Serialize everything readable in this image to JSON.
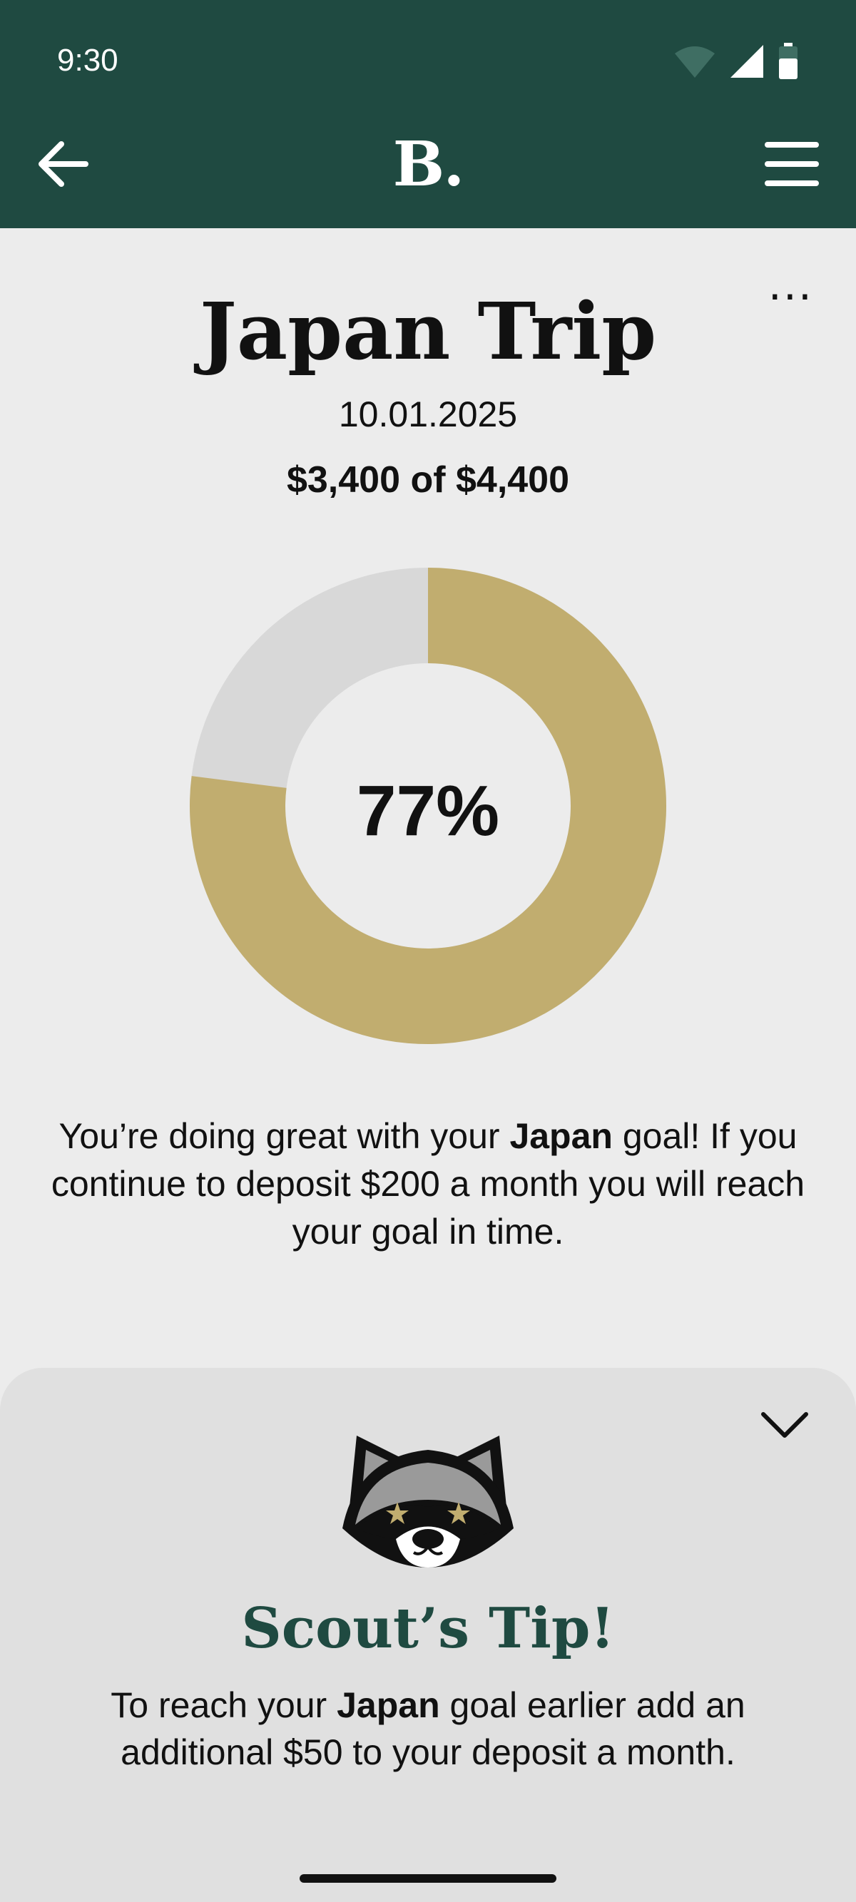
{
  "status_bar": {
    "time": "9:30"
  },
  "header": {
    "logo": "B.",
    "back_icon": "arrow-left-icon",
    "menu_icon": "hamburger-menu-icon"
  },
  "goal": {
    "more_label": "...",
    "title": "Japan Trip",
    "date": "10.01.2025",
    "amount_text": "$3,400 of $4,400",
    "saved": 3400,
    "target": 4400,
    "percent": 77,
    "percent_label": "77%",
    "message_pre": "You’re doing great with your ",
    "message_bold": "Japan",
    "message_post": " goal! If you continue to deposit $200 a month you will reach your goal in time."
  },
  "colors": {
    "header_bg": "#1f4a41",
    "progress_fill": "#c1ad6f",
    "progress_track": "#d8d8d8",
    "accent_green": "#1f4a41"
  },
  "tip": {
    "mascot_icon": "raccoon-mascot-icon",
    "collapse_icon": "chevron-down-icon",
    "title": "Scout’s Tip!",
    "text_pre": "To reach your ",
    "text_bold": "Japan",
    "text_post": " goal earlier add an additional $50 to your deposit a month."
  }
}
